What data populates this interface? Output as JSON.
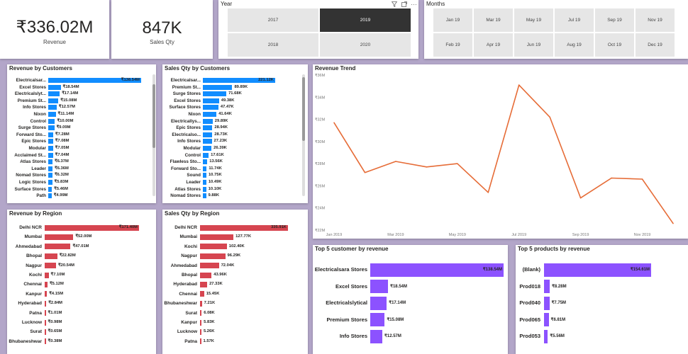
{
  "kpis": {
    "revenue": {
      "value": "₹336.02M",
      "label": "Revenue"
    },
    "sales_qty": {
      "value": "847K",
      "label": "Sales Qty"
    }
  },
  "year_slicer": {
    "title": "Year",
    "options": [
      "2017",
      "2019",
      "2018",
      "2020"
    ],
    "selected": "2019"
  },
  "month_slicer": {
    "title": "Months",
    "options": [
      "Jan 19",
      "Mar 19",
      "May 19",
      "Jul 19",
      "Sep 19",
      "Nov 19",
      "Feb 19",
      "Apr 19",
      "Jun 19",
      "Aug 19",
      "Oct 19",
      "Dec 19"
    ]
  },
  "colors": {
    "customer_bar": "#118dff",
    "region_bar": "#d64550",
    "top5_bar": "#8c52ff",
    "trend_line": "#e66c37"
  },
  "icons": [
    "filter-icon",
    "focus-mode-icon",
    "more-options-icon"
  ],
  "revenue_by_customers": {
    "title": "Revenue by Customers",
    "rows": [
      {
        "label": "Electricalsar...",
        "value": 138.54,
        "text": "₹138.54M"
      },
      {
        "label": "Excel Stores",
        "value": 18.54,
        "text": "₹18.54M"
      },
      {
        "label": "Electricalslyt...",
        "value": 17.14,
        "text": "₹17.14M"
      },
      {
        "label": "Premium St...",
        "value": 15.08,
        "text": "₹15.08M"
      },
      {
        "label": "Info Stores",
        "value": 12.57,
        "text": "₹12.57M"
      },
      {
        "label": "Nixon",
        "value": 11.14,
        "text": "₹11.14M"
      },
      {
        "label": "Control",
        "value": 10.0,
        "text": "₹10.00M"
      },
      {
        "label": "Surge Stores",
        "value": 9.09,
        "text": "₹9.09M"
      },
      {
        "label": "Forward Sto...",
        "value": 7.28,
        "text": "₹7.28M"
      },
      {
        "label": "Epic Stores",
        "value": 7.08,
        "text": "₹7.08M"
      },
      {
        "label": "Modular",
        "value": 7.05,
        "text": "₹7.05M"
      },
      {
        "label": "Acclaimed St...",
        "value": 7.04,
        "text": "₹7.04M"
      },
      {
        "label": "Atlas Stores",
        "value": 6.37,
        "text": "₹6.37M"
      },
      {
        "label": "Leader",
        "value": 6.36,
        "text": "₹6.36M"
      },
      {
        "label": "Nomad Stores",
        "value": 6.32,
        "text": "₹6.32M"
      },
      {
        "label": "Logic Stores",
        "value": 5.83,
        "text": "₹5.83M"
      },
      {
        "label": "Surface Stores",
        "value": 5.46,
        "text": "₹5.46M"
      },
      {
        "label": "Path",
        "value": 4.99,
        "text": "₹4.99M"
      }
    ]
  },
  "sales_qty_by_customers": {
    "title": "Sales Qty by Customers",
    "rows": [
      {
        "label": "Electricalsar...",
        "value": 221.12,
        "text": "221.12K"
      },
      {
        "label": "Premium St...",
        "value": 89.89,
        "text": "89.89K"
      },
      {
        "label": "Surge Stores",
        "value": 71.68,
        "text": "71.68K"
      },
      {
        "label": "Excel Stores",
        "value": 49.38,
        "text": "49.38K"
      },
      {
        "label": "Surface Stores",
        "value": 47.47,
        "text": "47.47K"
      },
      {
        "label": "Nixon",
        "value": 41.64,
        "text": "41.64K"
      },
      {
        "label": "Electricallys...",
        "value": 29.89,
        "text": "29.89K"
      },
      {
        "label": "Epic Stores",
        "value": 28.94,
        "text": "28.94K"
      },
      {
        "label": "Electricalso...",
        "value": 28.73,
        "text": "28.73K"
      },
      {
        "label": "Info Stores",
        "value": 27.23,
        "text": "27.23K"
      },
      {
        "label": "Modular",
        "value": 26.39,
        "text": "26.39K"
      },
      {
        "label": "Control",
        "value": 17.61,
        "text": "17.61K"
      },
      {
        "label": "Flawless Sto...",
        "value": 13.56,
        "text": "13.56K"
      },
      {
        "label": "Forward Sto...",
        "value": 11.74,
        "text": "11.74K"
      },
      {
        "label": "Sound",
        "value": 10.75,
        "text": "10.75K"
      },
      {
        "label": "Leader",
        "value": 10.49,
        "text": "10.49K"
      },
      {
        "label": "Atlas Stores",
        "value": 10.1,
        "text": "10.10K"
      },
      {
        "label": "Nomad Stores",
        "value": 9.88,
        "text": "9.88K"
      }
    ]
  },
  "revenue_by_region": {
    "title": "Revenue by Region",
    "rows": [
      {
        "label": "Delhi NCR",
        "value": 171.4,
        "text": "₹171.40M"
      },
      {
        "label": "Mumbai",
        "value": 52.0,
        "text": "₹52.00M"
      },
      {
        "label": "Ahmedabad",
        "value": 47.01,
        "text": "₹47.01M"
      },
      {
        "label": "Bhopal",
        "value": 22.82,
        "text": "₹22.82M"
      },
      {
        "label": "Nagpur",
        "value": 20.54,
        "text": "₹20.54M"
      },
      {
        "label": "Kochi",
        "value": 7.1,
        "text": "₹7.10M"
      },
      {
        "label": "Chennai",
        "value": 5.12,
        "text": "₹5.12M"
      },
      {
        "label": "Kanpur",
        "value": 4.15,
        "text": "₹4.15M"
      },
      {
        "label": "Hyderabad",
        "value": 2.84,
        "text": "₹2.84M"
      },
      {
        "label": "Patna",
        "value": 1.01,
        "text": "₹1.01M"
      },
      {
        "label": "Lucknow",
        "value": 0.98,
        "text": "₹0.98M"
      },
      {
        "label": "Surat",
        "value": 0.65,
        "text": "₹0.65M"
      },
      {
        "label": "Bhubaneshwar",
        "value": 0.38,
        "text": "₹0.38M"
      }
    ]
  },
  "sales_qty_by_region": {
    "title": "Sales Qty by Region",
    "rows": [
      {
        "label": "Delhi NCR",
        "value": 335.91,
        "text": "335.91K"
      },
      {
        "label": "Mumbai",
        "value": 127.77,
        "text": "127.77K"
      },
      {
        "label": "Kochi",
        "value": 102.4,
        "text": "102.40K"
      },
      {
        "label": "Nagpur",
        "value": 96.29,
        "text": "96.29K"
      },
      {
        "label": "Ahmedabad",
        "value": 72.04,
        "text": "72.04K"
      },
      {
        "label": "Bhopal",
        "value": 43.96,
        "text": "43.96K"
      },
      {
        "label": "Hyderabad",
        "value": 27.33,
        "text": "27.33K"
      },
      {
        "label": "Chennai",
        "value": 15.45,
        "text": "15.45K"
      },
      {
        "label": "Bhubaneshwar",
        "value": 7.21,
        "text": "7.21K"
      },
      {
        "label": "Surat",
        "value": 6.08,
        "text": "6.08K"
      },
      {
        "label": "Kanpur",
        "value": 5.83,
        "text": "5.83K"
      },
      {
        "label": "Lucknow",
        "value": 5.26,
        "text": "5.26K"
      },
      {
        "label": "Patna",
        "value": 1.57,
        "text": "1.57K"
      }
    ]
  },
  "top5_customers": {
    "title": "Top 5 customer by revenue",
    "rows": [
      {
        "label": "Electricalsara Stores",
        "value": 138.54,
        "text": "₹138.54M"
      },
      {
        "label": "Excel Stores",
        "value": 18.54,
        "text": "₹18.54M"
      },
      {
        "label": "Electricalslytical",
        "value": 17.14,
        "text": "₹17.14M"
      },
      {
        "label": "Premium Stores",
        "value": 15.08,
        "text": "₹15.08M"
      },
      {
        "label": "Info Stores",
        "value": 12.57,
        "text": "₹12.57M"
      }
    ]
  },
  "top5_products": {
    "title": "Top 5 products by revenue",
    "rows": [
      {
        "label": "(Blank)",
        "value": 154.61,
        "text": "₹154.61M"
      },
      {
        "label": "Prod018",
        "value": 8.28,
        "text": "₹8.28M"
      },
      {
        "label": "Prod040",
        "value": 7.75,
        "text": "₹7.75M"
      },
      {
        "label": "Prod065",
        "value": 6.81,
        "text": "₹6.81M"
      },
      {
        "label": "Prod053",
        "value": 5.56,
        "text": "₹5.56M"
      }
    ]
  },
  "chart_data": {
    "type": "line",
    "title": "Revenue Trend",
    "x": [
      "Jan 2019",
      "Feb 2019",
      "Mar 2019",
      "Apr 2019",
      "May 2019",
      "Jun 2019",
      "Jul 2019",
      "Aug 2019",
      "Sep 2019",
      "Oct 2019",
      "Nov 2019",
      "Dec 2019"
    ],
    "x_tick_labels": [
      "Jan 2019",
      "Mar 2019",
      "May 2019",
      "Jul 2019",
      "Sep 2019",
      "Nov 2019"
    ],
    "y_tick_labels": [
      "₹22M",
      "₹24M",
      "₹26M",
      "₹28M",
      "₹30M",
      "₹32M",
      "₹34M",
      "₹36M"
    ],
    "series": [
      {
        "values": [
          31.7,
          27.2,
          28.2,
          27.7,
          28.0,
          25.4,
          35.1,
          32.2,
          24.9,
          26.7,
          26.6,
          22.6
        ]
      }
    ],
    "ylim": [
      22,
      36
    ],
    "grid": false
  }
}
